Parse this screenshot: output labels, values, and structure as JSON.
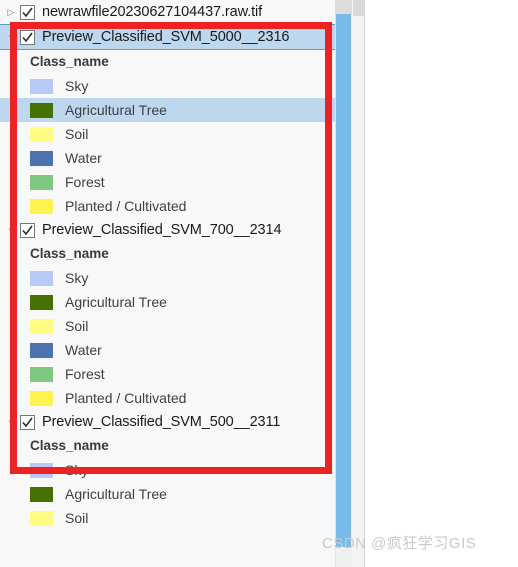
{
  "panel": {
    "name": "contents-pane",
    "legend_header_label": "Class_name",
    "tree": [
      {
        "type": "raster-layer",
        "name": "newrawfile20230627104437.raw.tif",
        "checked": true,
        "expander": "▷",
        "expanded": false,
        "selected": false,
        "legend": []
      },
      {
        "type": "classified-layer",
        "name": "Preview_Classified_SVM_5000__2316",
        "checked": true,
        "expander": "▿",
        "expanded": true,
        "selected": true,
        "legend": [
          {
            "label": "Sky",
            "color": "#b9c9f5"
          },
          {
            "label": "Agricultural Tree",
            "color": "#467000",
            "selected": true
          },
          {
            "label": "Soil",
            "color": "#fdfd81"
          },
          {
            "label": "Water",
            "color": "#4d72ad"
          },
          {
            "label": "Forest",
            "color": "#7fc882"
          },
          {
            "label": "Planted / Cultivated",
            "color": "#fcf250"
          }
        ]
      },
      {
        "type": "classified-layer",
        "name": "Preview_Classified_SVM_700__2314",
        "checked": true,
        "expander": "▿",
        "expanded": true,
        "selected": false,
        "legend": [
          {
            "label": "Sky",
            "color": "#b9c9f5"
          },
          {
            "label": "Agricultural Tree",
            "color": "#467000"
          },
          {
            "label": "Soil",
            "color": "#fdfd81"
          },
          {
            "label": "Water",
            "color": "#4d72ad"
          },
          {
            "label": "Forest",
            "color": "#7fc882"
          },
          {
            "label": "Planted / Cultivated",
            "color": "#fcf250"
          }
        ]
      },
      {
        "type": "classified-layer",
        "name": "Preview_Classified_SVM_500__2311",
        "checked": true,
        "expander": "▿",
        "expanded": true,
        "selected": false,
        "legend": [
          {
            "label": "Sky",
            "color": "#b9c9f5"
          },
          {
            "label": "Agricultural Tree",
            "color": "#467000"
          },
          {
            "label": "Soil",
            "color": "#fdfd81"
          }
        ]
      }
    ]
  },
  "annotation": {
    "name": "red-highlight-rectangle",
    "color": "#ee2222"
  },
  "scrollbar": {
    "name": "vertical-scrollbar",
    "thumb_color": "#79bbe8"
  },
  "watermark": {
    "text": "CSDN @疯狂学习GIS"
  }
}
